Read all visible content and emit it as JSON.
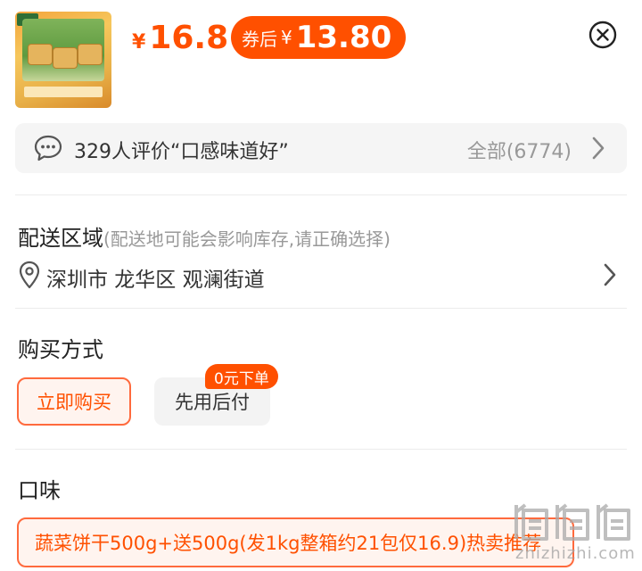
{
  "product": {
    "price_symbol": "¥",
    "price": "16.8",
    "coupon_label": "券后",
    "coupon_symbol": "¥",
    "coupon_price": "13.80"
  },
  "review": {
    "summary": "329人评价“口感味道好”",
    "all_label": "全部(6774)"
  },
  "delivery": {
    "title": "配送区域",
    "hint": "(配送地可能会影响库存,请正确选择)",
    "address": "深圳市 龙华区 观澜街道"
  },
  "purchase": {
    "title": "购买方式",
    "buy_now": "立即购买",
    "pay_later": "先用后付",
    "pay_later_badge": "0元下单"
  },
  "flavor": {
    "title": "口味",
    "option": "蔬菜饼干500g+送500g(发1kg整箱约21包仅16.9)热卖推荐"
  },
  "watermark": {
    "text": "zhizhizhi.com"
  },
  "colors": {
    "accent": "#ff5000",
    "accent_light_bg": "#fff4ef",
    "muted_text": "#999999"
  }
}
